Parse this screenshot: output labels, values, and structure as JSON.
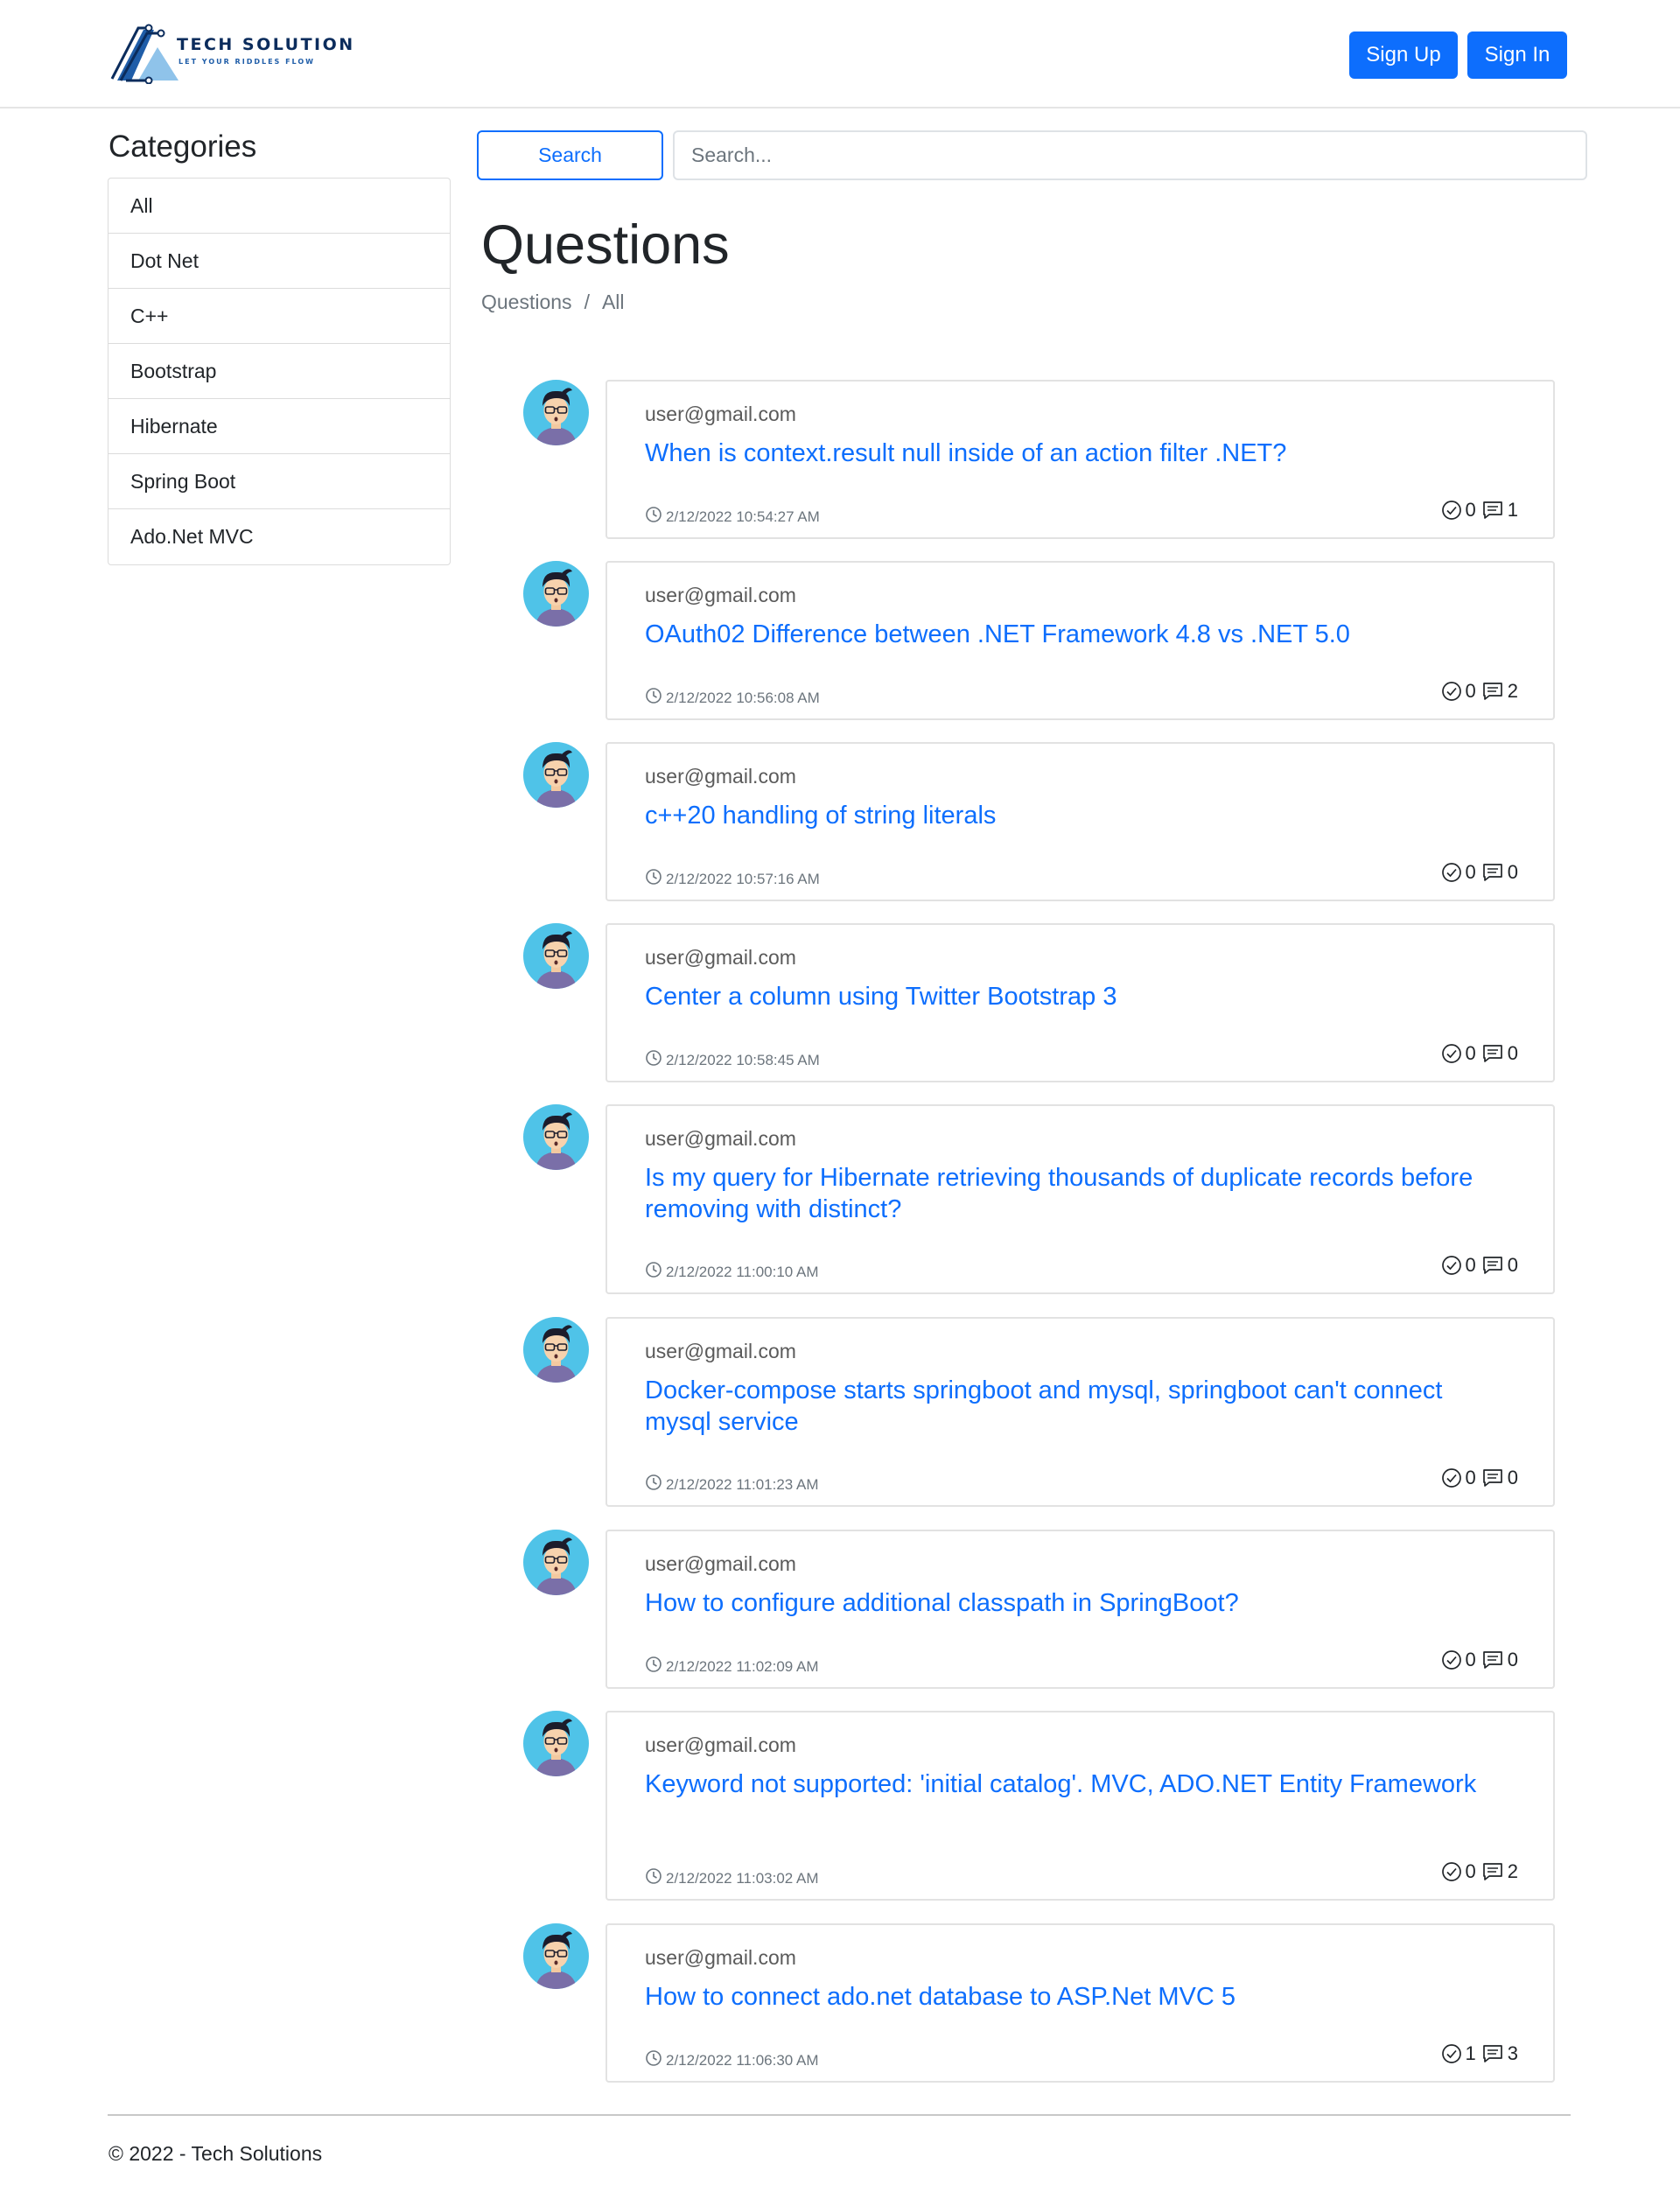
{
  "brand": {
    "name": "TECH SOLUTION",
    "tagline": "LET YOUR RIDDLES FLOW"
  },
  "nav": {
    "signup_label": "Sign Up",
    "signin_label": "Sign In"
  },
  "sidebar": {
    "title": "Categories",
    "items": [
      "All",
      "Dot Net",
      "C++",
      "Bootstrap",
      "Hibernate",
      "Spring Boot",
      "Ado.Net MVC"
    ]
  },
  "search": {
    "button_label": "Search",
    "placeholder": "Search..."
  },
  "main": {
    "title": "Questions",
    "breadcrumb": [
      "Questions",
      "/",
      "All"
    ]
  },
  "questions": [
    {
      "user": "user@gmail.com",
      "title": "When is context.result null inside of an action filter .NET?",
      "time": "2/12/2022 10:54:27 AM",
      "answers": "0",
      "comments": "1"
    },
    {
      "user": "user@gmail.com",
      "title": "OAuth02 Difference between .NET Framework 4.8 vs .NET 5.0",
      "time": "2/12/2022 10:56:08 AM",
      "answers": "0",
      "comments": "2"
    },
    {
      "user": "user@gmail.com",
      "title": "c++20 handling of string literals",
      "time": "2/12/2022 10:57:16 AM",
      "answers": "0",
      "comments": "0"
    },
    {
      "user": "user@gmail.com",
      "title": "Center a column using Twitter Bootstrap 3",
      "time": "2/12/2022 10:58:45 AM",
      "answers": "0",
      "comments": "0"
    },
    {
      "user": "user@gmail.com",
      "title": "Is my query for Hibernate retrieving thousands of duplicate records before removing with distinct?",
      "time": "2/12/2022 11:00:10 AM",
      "answers": "0",
      "comments": "0"
    },
    {
      "user": "user@gmail.com",
      "title": "Docker-compose starts springboot and mysql, springboot can't connect mysql service",
      "time": "2/12/2022 11:01:23 AM",
      "answers": "0",
      "comments": "0"
    },
    {
      "user": "user@gmail.com",
      "title": "How to configure additional classpath in SpringBoot?",
      "time": "2/12/2022 11:02:09 AM",
      "answers": "0",
      "comments": "0"
    },
    {
      "user": "user@gmail.com",
      "title": "Keyword not supported: 'initial catalog'. MVC, ADO.NET Entity Framework",
      "time": "2/12/2022 11:03:02 AM",
      "answers": "0",
      "comments": "2"
    },
    {
      "user": "user@gmail.com",
      "title": "How to connect ado.net database to ASP.Net MVC 5",
      "time": "2/12/2022 11:06:30 AM",
      "answers": "1",
      "comments": "3"
    }
  ],
  "footer": {
    "text": "© 2022 - Tech Solutions"
  },
  "colors": {
    "primary": "#0d6efd",
    "avatar_bg": "#4fc3e8"
  }
}
